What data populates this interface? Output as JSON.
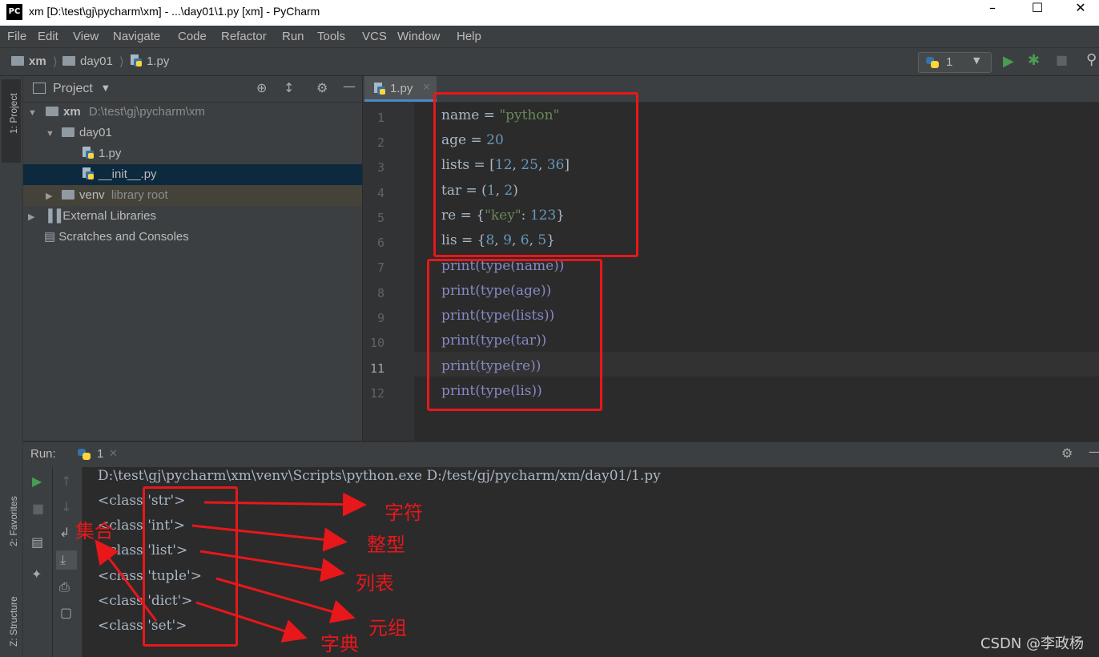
{
  "window": {
    "title": "xm [D:\\test\\gj\\pycharm\\xm] - ...\\day01\\1.py [xm] - PyCharm",
    "app_icon": "PC"
  },
  "menu": [
    "File",
    "Edit",
    "View",
    "Navigate",
    "Code",
    "Refactor",
    "Run",
    "Tools",
    "VCS",
    "Window",
    "Help"
  ],
  "breadcrumb": [
    "xm",
    "day01",
    "1.py"
  ],
  "run_config": {
    "label": "1"
  },
  "left_strip": {
    "project_tab": "1: Project",
    "favorites_tab": "2: Favorites",
    "structure_tab": "Z: Structure"
  },
  "project": {
    "header": "Project",
    "tree": [
      {
        "name": "xm",
        "detail": "D:\\test\\gj\\pycharm\\xm"
      },
      {
        "name": "day01",
        "detail": ""
      },
      {
        "name": "1.py",
        "detail": ""
      },
      {
        "name": "__init__.py",
        "detail": ""
      },
      {
        "name": "venv",
        "detail": "library root"
      },
      {
        "name": "External Libraries",
        "detail": ""
      },
      {
        "name": "Scratches and Consoles",
        "detail": ""
      }
    ]
  },
  "editor": {
    "tab": "1.py",
    "line_numbers": [
      "1",
      "2",
      "3",
      "4",
      "5",
      "6",
      "7",
      "8",
      "9",
      "10",
      "11",
      "12"
    ],
    "lines": [
      "name = \"python\"",
      "age = 20",
      "lists = [12, 25, 36]",
      "tar = (1, 2)",
      "re = {\"key\": 123}",
      "lis = {8, 9, 6, 5}",
      "print(type(name))",
      "print(type(age))",
      "print(type(lists))",
      "print(type(tar))",
      "print(type(re))",
      "print(type(lis))"
    ]
  },
  "run": {
    "label": "Run:",
    "tab": "1",
    "command": "D:\\test\\gj\\pycharm\\xm\\venv\\Scripts\\python.exe D:/test/gj/pycharm/xm/day01/1.py",
    "output": [
      "<class 'str'>",
      "<class 'int'>",
      "<class 'list'>",
      "<class 'tuple'>",
      "<class 'dict'>",
      "<class 'set'>"
    ]
  },
  "annotations": {
    "str": "字符",
    "int": "整型",
    "list": "列表",
    "tuple": "元组",
    "dict": "字典",
    "set": "集合"
  },
  "watermark": "CSDN @李政杨",
  "colors": {
    "annotation_red": "#e8171a",
    "string_green": "#6a8759",
    "number_blue": "#6897bb",
    "builtin_purple": "#8888c6"
  }
}
